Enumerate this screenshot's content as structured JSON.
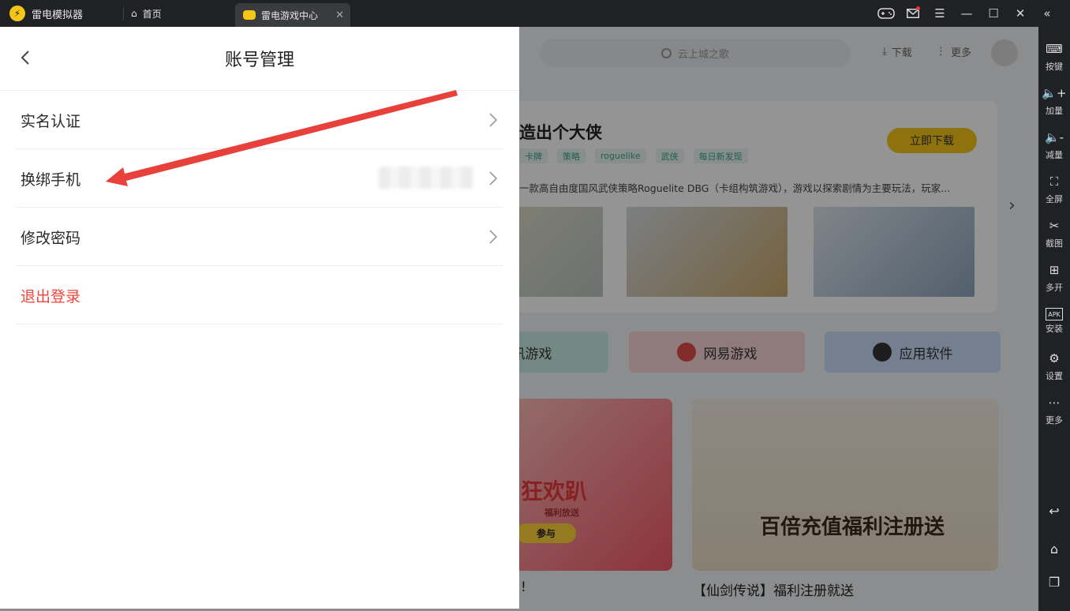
{
  "titlebar": {
    "app_name": "雷电模拟器",
    "tabs": [
      {
        "label": "首页",
        "active": false
      },
      {
        "label": "雷电游戏中心",
        "active": true
      }
    ],
    "icons": [
      "gamepad-icon",
      "mail-icon",
      "menu-icon",
      "minimize-icon",
      "maximize-icon",
      "close-icon",
      "collapse-icon"
    ]
  },
  "sidebar": {
    "items": [
      {
        "label": "按键",
        "icon": "keyboard-icon"
      },
      {
        "label": "加量",
        "icon": "volume-up-icon"
      },
      {
        "label": "减量",
        "icon": "volume-down-icon"
      },
      {
        "label": "全屏",
        "icon": "fullscreen-icon"
      },
      {
        "label": "截图",
        "icon": "scissors-icon"
      },
      {
        "label": "多开",
        "icon": "multi-instance-icon"
      },
      {
        "label": "安装",
        "icon": "apk-install-icon"
      },
      {
        "label": "设置",
        "icon": "settings-icon"
      },
      {
        "label": "更多",
        "icon": "more-icon"
      }
    ],
    "nav": [
      "back-icon",
      "home-icon",
      "recent-apps-icon"
    ]
  },
  "background": {
    "search_placeholder": "云上城之歌",
    "download_label": "下载",
    "more_label": "更多",
    "featured": {
      "title": "造出个大侠",
      "tags": [
        "卡牌",
        "策略",
        "roguelike",
        "武侠",
        "每日新发现"
      ],
      "download_button": "立即下载",
      "description": "一款高自由度国风武侠策略Roguelite DBG（卡组构筑游戏），游戏以探索剧情为主要玩法，玩家..."
    },
    "categories": [
      {
        "label": "腾讯游戏",
        "color": "#c9ece3"
      },
      {
        "label": "网易游戏",
        "color": "#f7d3d6"
      },
      {
        "label": "应用软件",
        "color": "#c8dcf6"
      }
    ],
    "banners": [
      {
        "text": "狂欢趴",
        "sub": "福利放送",
        "button": "参与",
        "caption": "!"
      },
      {
        "text": "百倍充值福利注册送",
        "caption": "【仙剑传说】福利注册就送"
      }
    ]
  },
  "panel": {
    "title": "账号管理",
    "rows": [
      {
        "label": "实名认证",
        "chevron": true
      },
      {
        "label": "换绑手机",
        "chevron": true,
        "value_blurred": true
      },
      {
        "label": "修改密码",
        "chevron": true
      },
      {
        "label": "退出登录",
        "chevron": false,
        "danger": true
      }
    ]
  },
  "annotation": {
    "color": "#e8403a"
  }
}
